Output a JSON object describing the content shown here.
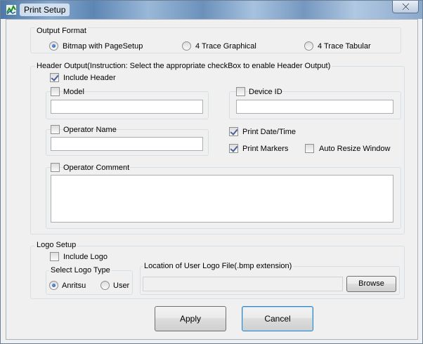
{
  "window": {
    "title": "Print Setup",
    "accent": "#4d78a8"
  },
  "output_format": {
    "legend": "Output Format",
    "options": [
      {
        "label": "Bitmap with PageSetup",
        "selected": true
      },
      {
        "label": "4 Trace Graphical",
        "selected": false
      },
      {
        "label": "4 Trace Tabular",
        "selected": false
      }
    ]
  },
  "header_output": {
    "legend": "Header Output(Instruction: Select the appropriate checkBox to enable Header Output)",
    "include_header": {
      "label": "Include Header",
      "checked": true
    },
    "model": {
      "label": "Model",
      "checked": false,
      "value": ""
    },
    "device_id": {
      "label": "Device ID",
      "checked": false,
      "value": ""
    },
    "operator_name": {
      "label": "Operator Name",
      "checked": false,
      "value": ""
    },
    "print_datetime": {
      "label": "Print Date/Time",
      "checked": true
    },
    "print_markers": {
      "label": "Print Markers",
      "checked": true
    },
    "auto_resize": {
      "label": "Auto Resize Window",
      "checked": false
    },
    "operator_comment": {
      "label": "Operator Comment",
      "checked": false,
      "value": ""
    }
  },
  "logo_setup": {
    "legend": "Logo Setup",
    "include_logo": {
      "label": "Include Logo",
      "checked": false
    },
    "select_logo_type": {
      "legend": "Select Logo Type",
      "options": [
        {
          "label": "Anritsu",
          "selected": true
        },
        {
          "label": "User",
          "selected": false
        }
      ]
    },
    "location": {
      "legend": "Location of User Logo File(.bmp extension)",
      "value": ""
    },
    "browse_label": "Browse"
  },
  "buttons": {
    "apply": "Apply",
    "cancel": "Cancel"
  }
}
